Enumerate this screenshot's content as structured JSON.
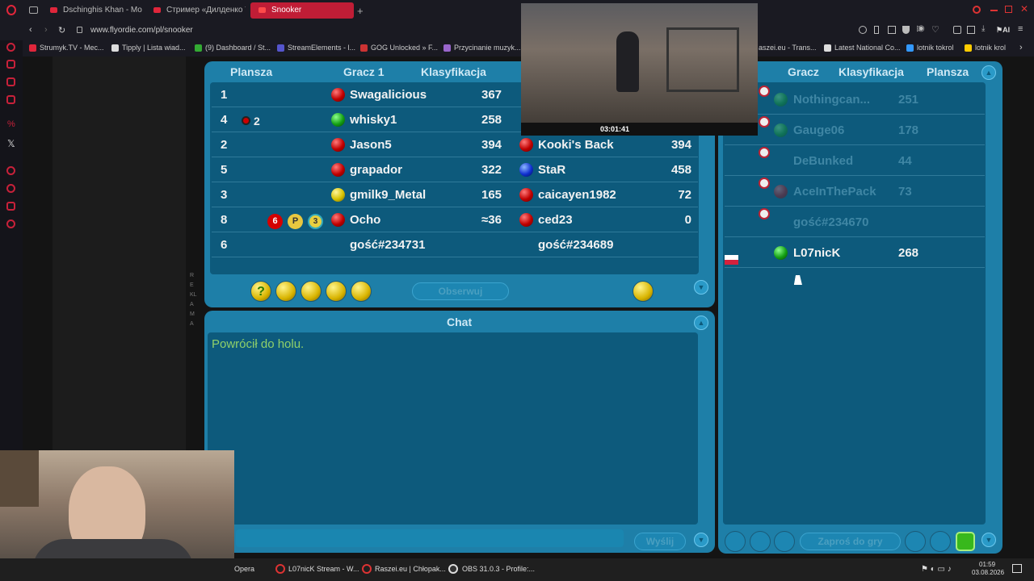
{
  "tabs": [
    {
      "label": "Dschinghis Khan - Mos"
    },
    {
      "label": "Стример «Дилденко TV» |"
    },
    {
      "label": "Snooker",
      "active": true
    }
  ],
  "url": "www.flyordie.com/pl/snooker",
  "bookmarks": [
    "Strumyk.TV - Mec...",
    "Tipply | Lista wiad...",
    "(9) Dashboard / St...",
    "StreamElements - l...",
    "GOG Unlocked » F...",
    "Przycinanie muzyk...",
    "aszei.eu - Trans...",
    "Latest National Co...",
    "lotnik tokrol",
    "lotnik krol"
  ],
  "tables": {
    "headers": {
      "board": "Plansza",
      "player1": "Gracz 1",
      "rank": "Klasyfikacja"
    },
    "rows": [
      {
        "board": "1",
        "extra": "",
        "p1": "Swagalicious",
        "p1_ball": "red",
        "r1": "367",
        "p2": "",
        "p2_ball": "",
        "r2": ""
      },
      {
        "board": "4",
        "extra": "2",
        "p1": "whisky1",
        "p1_ball": "green",
        "r1": "258",
        "p2": "",
        "p2_ball": "",
        "r2": ""
      },
      {
        "board": "2",
        "extra": "",
        "p1": "Jason5",
        "p1_ball": "red",
        "r1": "394",
        "p2": "Kooki's Back",
        "p2_ball": "red",
        "r2": "394"
      },
      {
        "board": "5",
        "extra": "",
        "p1": "grapador",
        "p1_ball": "red",
        "r1": "322",
        "p2": "StaR",
        "p2_ball": "blue",
        "r2": "458"
      },
      {
        "board": "3",
        "extra": "",
        "p1": "gmilk9_Metal",
        "p1_ball": "yellow",
        "r1": "165",
        "p2": "caicayen1982",
        "p2_ball": "red",
        "r2": "72"
      },
      {
        "board": "8",
        "extra": "",
        "p1": "Ocho",
        "p1_ball": "red",
        "r1": "≈36",
        "p2": "ced23",
        "p2_ball": "red",
        "r2": "0"
      },
      {
        "board": "6",
        "extra": "",
        "p1": "gość#234731",
        "p1_ball": "",
        "r1": "",
        "p2": "gość#234689",
        "p2_ball": "",
        "r2": ""
      }
    ],
    "badges": {
      "badge_6": "6",
      "badge_p": "P",
      "badge_3": "3"
    }
  },
  "toolbar": {
    "observe": "Obserwuj"
  },
  "chat": {
    "title": "Chat",
    "message": "Powrócił do holu.",
    "send": "Wyślij"
  },
  "players": {
    "headers": {
      "player": "Gracz",
      "rank": "Klasyfikacja",
      "board": "Plansza"
    },
    "rows": [
      {
        "name": "Nothingcan...",
        "rank": "251",
        "ball": "green",
        "dim": true
      },
      {
        "name": "Gauge06",
        "rank": "178",
        "ball": "green",
        "dim": true
      },
      {
        "name": "DeBunked",
        "rank": "44",
        "ball": "",
        "dim": true
      },
      {
        "name": "AceInThePack",
        "rank": "73",
        "ball": "red",
        "dim": true
      },
      {
        "name": "gość#234670",
        "rank": "",
        "ball": "",
        "dim": true
      },
      {
        "name": "L07nicK",
        "rank": "268",
        "ball": "green",
        "dim": false
      }
    ],
    "invite": "Zaproś do gry"
  },
  "side_label": "REKLAMA",
  "stream_overlay": {
    "timer": "03:01:41"
  },
  "taskbar": {
    "items": [
      "Opera",
      "L07nicK Stream - W...",
      "Raszei.eu | Chłopak...",
      "OBS 31.0.3 - Profile:..."
    ],
    "time": "01:59",
    "date": "03.08.2026"
  }
}
